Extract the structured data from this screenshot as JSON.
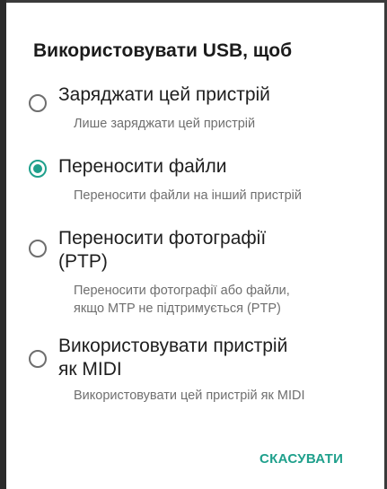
{
  "dialog": {
    "title": "Використовувати USB, щоб",
    "options": [
      {
        "label": "Заряджати цей пристрій",
        "description": "Лише заряджати цей пристрій",
        "selected": false
      },
      {
        "label": "Переносити файли",
        "description": "Переносити файли на інший пристрій",
        "selected": true
      },
      {
        "label": "Переносити фотографії\n(PTP)",
        "description": "Переносити фотографії або файли,\nякщо MTP не підтримується (PTP)",
        "selected": false
      },
      {
        "label": "Використовувати пристрій\nяк MIDI",
        "description": "Використовувати цей пристрій як MIDI",
        "selected": false
      }
    ],
    "cancel_label": "СКАСУВАТИ"
  },
  "colors": {
    "accent": "#1fa08c",
    "radio_unchecked": "#6e6e6e",
    "primary_text": "#1e1e1e",
    "secondary_text": "#6f6f6f"
  }
}
